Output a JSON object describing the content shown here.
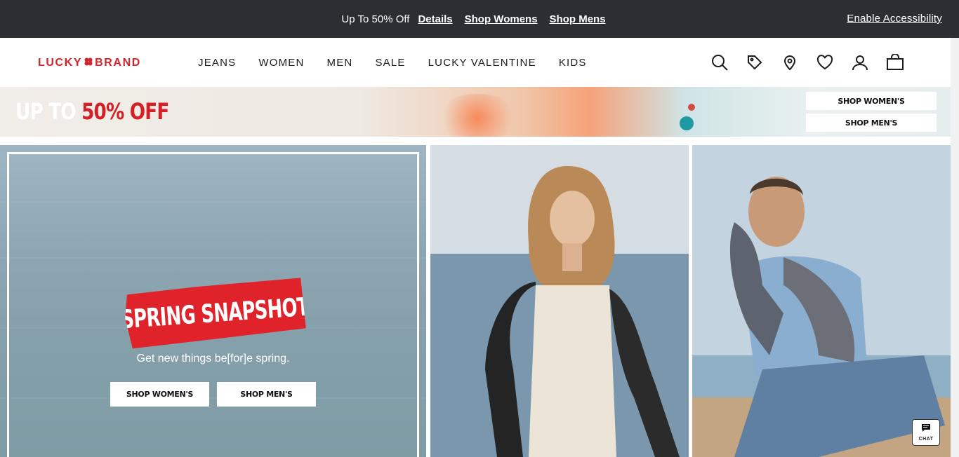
{
  "announcement": {
    "text": "Up To 50% Off",
    "links": [
      "Details",
      "Shop Womens",
      "Shop Mens"
    ],
    "accessibility": "Enable Accessibility"
  },
  "header": {
    "logo_left": "LUCKY",
    "logo_right": "BRAND",
    "nav": [
      "JEANS",
      "WOMEN",
      "MEN",
      "SALE",
      "LUCKY VALENTINE",
      "KIDS"
    ],
    "icons": [
      "search-icon",
      "tag-icon",
      "location-pin-icon",
      "heart-icon",
      "account-icon",
      "shopping-bag-icon"
    ]
  },
  "promo_banner": {
    "headline_white": "UP TO ",
    "headline_red": "50% OFF",
    "shop_womens": "SHOP WOMEN'S",
    "shop_mens": "SHOP MEN'S"
  },
  "hero": {
    "stamp": "SPRING SNAPSHOT",
    "tagline": "Get new things be[for]e spring.",
    "shop_womens": "SHOP WOMEN'S",
    "shop_mens": "SHOP MEN'S"
  },
  "chat": {
    "label": "CHAT"
  },
  "colors": {
    "brand_red": "#d4232b",
    "top_bar": "#2b2f33"
  }
}
